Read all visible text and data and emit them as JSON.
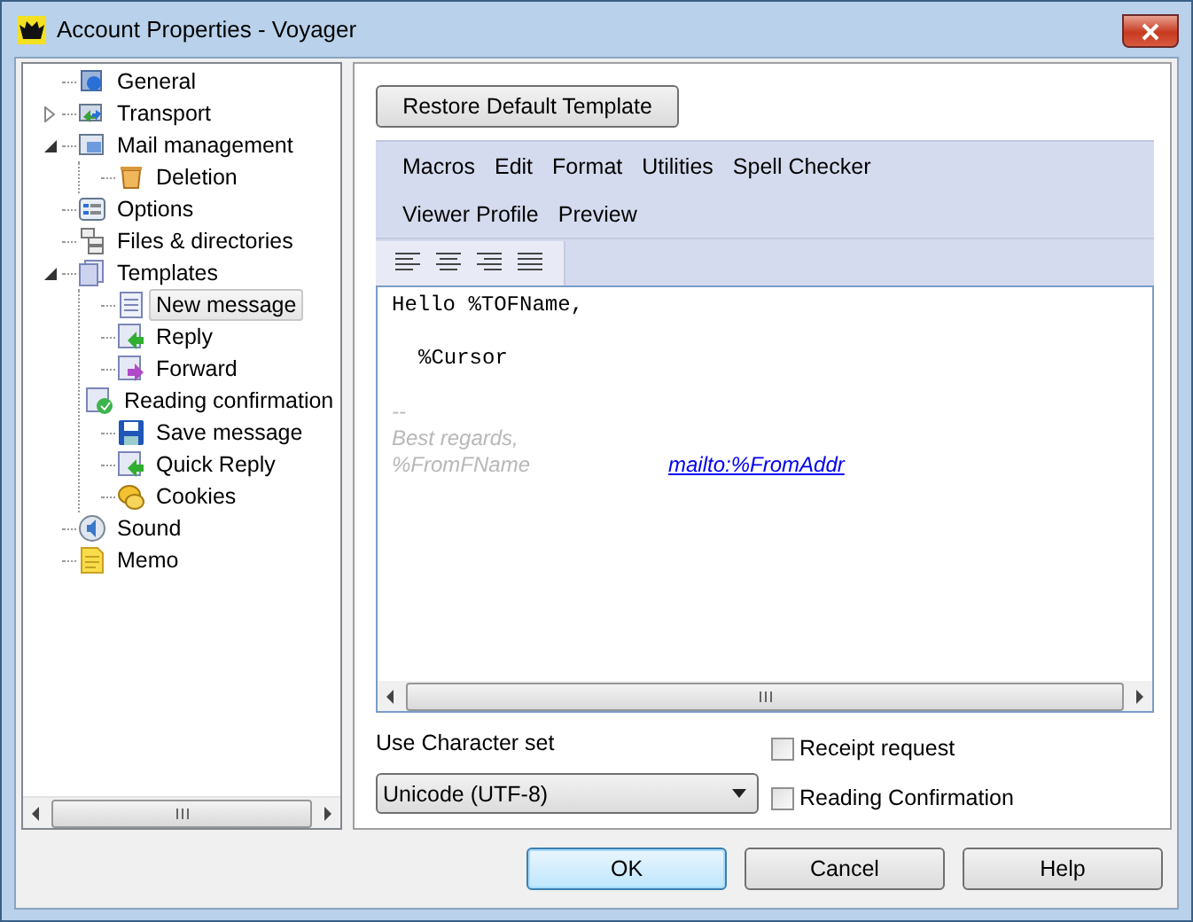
{
  "window": {
    "title": "Account Properties - Voyager"
  },
  "tree": [
    {
      "label": "General",
      "selected": false
    },
    {
      "label": "Transport",
      "selected": false,
      "expanded": false
    },
    {
      "label": "Mail management",
      "selected": false,
      "expanded": true,
      "children": [
        {
          "label": "Deletion",
          "selected": false
        }
      ]
    },
    {
      "label": "Options",
      "selected": false
    },
    {
      "label": "Files & directories",
      "selected": false
    },
    {
      "label": "Templates",
      "selected": false,
      "expanded": true,
      "children": [
        {
          "label": "New message",
          "selected": true
        },
        {
          "label": "Reply",
          "selected": false
        },
        {
          "label": "Forward",
          "selected": false
        },
        {
          "label": "Reading confirmation",
          "selected": false
        },
        {
          "label": "Save message",
          "selected": false
        },
        {
          "label": "Quick Reply",
          "selected": false
        },
        {
          "label": "Cookies",
          "selected": false
        }
      ]
    },
    {
      "label": "Sound",
      "selected": false
    },
    {
      "label": "Memo",
      "selected": false
    }
  ],
  "restore_button": "Restore Default Template",
  "menus": [
    [
      "Macros",
      "Edit",
      "Format",
      "Utilities",
      "Spell Checker"
    ],
    [
      "Viewer Profile",
      "Preview"
    ]
  ],
  "editor": {
    "lines": [
      {
        "kind": "code",
        "text": "Hello %TOFName,"
      },
      {
        "kind": "blank"
      },
      {
        "kind": "indented",
        "text": "%Cursor"
      },
      {
        "kind": "blank"
      },
      {
        "kind": "signature",
        "text": "--"
      },
      {
        "kind": "signature",
        "text": "Best regards,"
      },
      {
        "kind": "signature",
        "text": "%FromFName",
        "link": "mailto:%FromAddr"
      }
    ]
  },
  "charset": {
    "label": "Use Character set",
    "value": "Unicode (UTF-8)"
  },
  "options": [
    {
      "label": "Receipt request",
      "checked": false
    },
    {
      "label": "Reading Confirmation",
      "checked": false
    }
  ],
  "buttons": [
    {
      "label": "OK",
      "default": true
    },
    {
      "label": "Cancel",
      "default": false
    },
    {
      "label": "Help",
      "default": false
    }
  ]
}
